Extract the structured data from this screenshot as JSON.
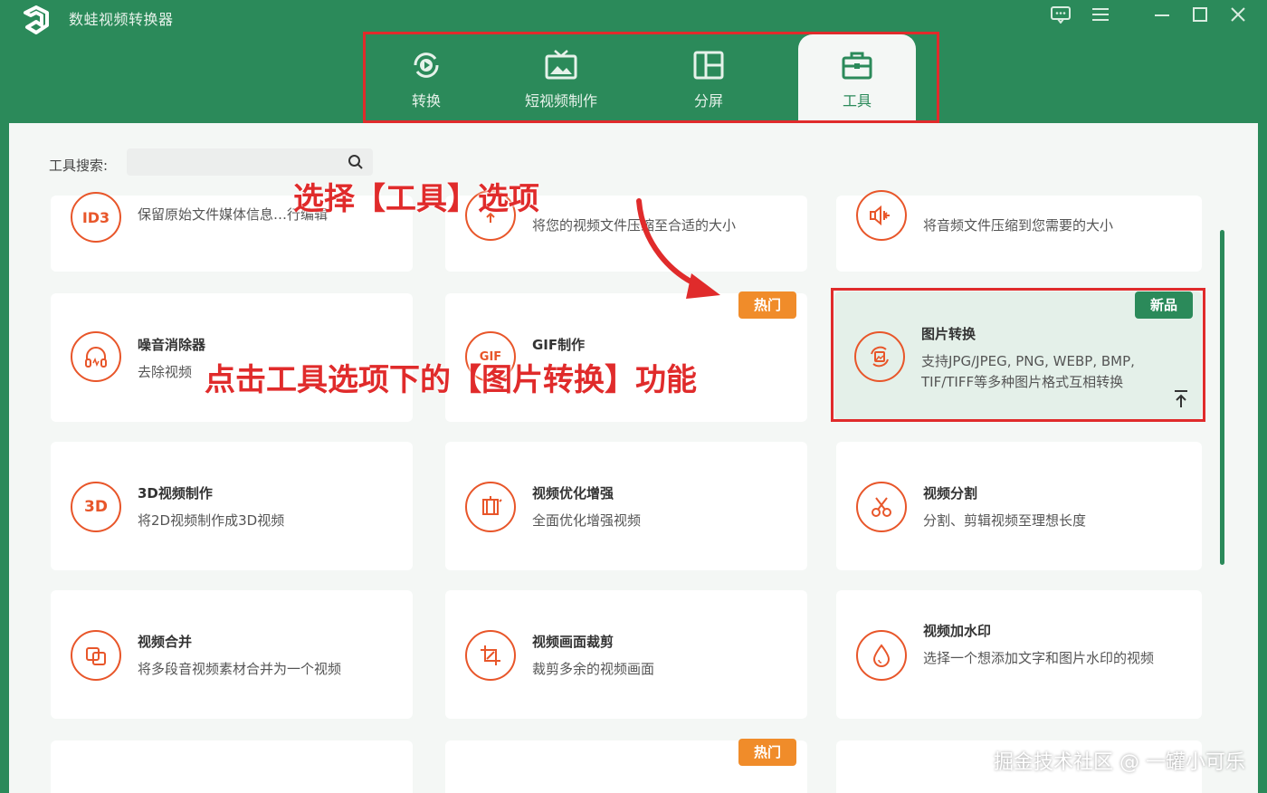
{
  "app": {
    "title": "数蛙视频转换器"
  },
  "tabs": [
    {
      "label": "转换",
      "icon": "convert-icon"
    },
    {
      "label": "短视频制作",
      "icon": "tv-icon"
    },
    {
      "label": "分屏",
      "icon": "split-screen-icon"
    },
    {
      "label": "工具",
      "icon": "toolbox-icon",
      "active": true
    }
  ],
  "search": {
    "label": "工具搜索:",
    "placeholder": ""
  },
  "tools": [
    {
      "title": "",
      "desc": "保留原始文件媒体信息…行编辑",
      "icon_text": "ID3"
    },
    {
      "title": "",
      "desc": "将您的视频文件压缩至合适的大小"
    },
    {
      "title": "",
      "desc": "将音频文件压缩到您需要的大小"
    },
    {
      "title": "噪音消除器",
      "desc": "去除视频"
    },
    {
      "title": "GIF制作",
      "desc": "",
      "badge": "热门"
    },
    {
      "title": "图片转换",
      "desc": "支持JPG/JPEG, PNG, WEBP, BMP, TIF/TIFF等多种图片格式互相转换",
      "badge": "新品"
    },
    {
      "title": "3D视频制作",
      "desc": "将2D视频制作成3D视频",
      "icon_text": "3D"
    },
    {
      "title": "视频优化增强",
      "desc": "全面优化增强视频"
    },
    {
      "title": "视频分割",
      "desc": "分割、剪辑视频至理想长度"
    },
    {
      "title": "视频合并",
      "desc": "将多段音视频素材合并为一个视频"
    },
    {
      "title": "视频画面裁剪",
      "desc": "裁剪多余的视频画面"
    },
    {
      "title": "视频加水印",
      "desc": "选择一个想添加文字和图片水印的视频"
    }
  ],
  "bottom_badge": "热门",
  "annotations": {
    "select_tab": "选择【工具】选项",
    "click_feature": "点击工具选项下的【图片转换】功能"
  },
  "watermark": "掘金技术社区 @ 一罐小可乐",
  "colors": {
    "brand_green": "#2b8a5a",
    "accent_orange": "#e8562a",
    "annotation_red": "#e02b2b"
  }
}
